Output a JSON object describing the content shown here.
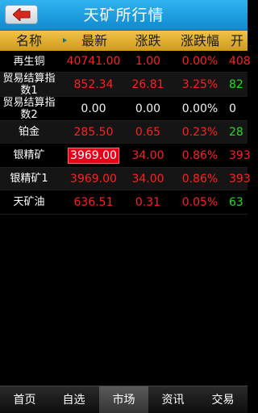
{
  "title": "天矿所行情",
  "header": {
    "name": "名称",
    "latest": "最新",
    "change": "涨跌",
    "change_pct": "涨跌幅",
    "open": "开"
  },
  "rows": [
    {
      "name": [
        "再生铜"
      ],
      "latest": "40741.00",
      "change": "1.00",
      "pct": "0.00%",
      "open": "408"
    },
    {
      "name": [
        "贸易结算指",
        "数1"
      ],
      "latest": "852.34",
      "change": "26.81",
      "pct": "3.25%",
      "open": "82"
    },
    {
      "name": [
        "贸易结算指",
        "数2"
      ],
      "latest": "0.00",
      "change": "0.00",
      "pct": "0.00%",
      "open": "0"
    },
    {
      "name": [
        "铂金"
      ],
      "latest": "285.50",
      "change": "0.65",
      "pct": "0.23%",
      "open": "28"
    },
    {
      "name": [
        "银精矿"
      ],
      "latest": "3969.00",
      "change": "34.00",
      "pct": "0.86%",
      "open": "393"
    },
    {
      "name": [
        "银精矿1"
      ],
      "latest": "3969.00",
      "change": "34.00",
      "pct": "0.86%",
      "open": "393"
    },
    {
      "name": [
        "天矿油"
      ],
      "latest": "636.51",
      "change": "0.31",
      "pct": "0.05%",
      "open": "63"
    }
  ],
  "nav": [
    "首页",
    "自选",
    "市场",
    "资讯",
    "交易"
  ],
  "colors": {
    "up": "#ff2020",
    "flat": "#f2f2f2",
    "open_up": "#22dd22",
    "highlight": "#e6001a",
    "titlebar": "#1a9de0",
    "header": "#e2ae2c"
  },
  "icons": {
    "back": "back-arrow-icon"
  }
}
